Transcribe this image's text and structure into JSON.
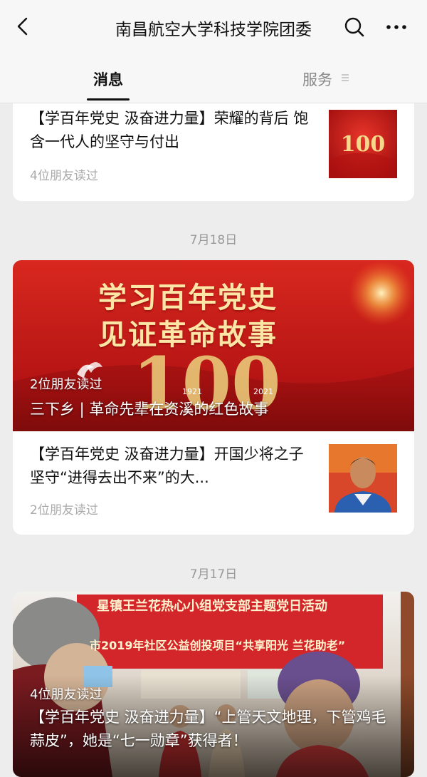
{
  "header": {
    "title": "南昌航空大学科技学院团委",
    "back_icon": "chevron-left-icon",
    "search_icon": "search-icon",
    "more_icon": "more-icon"
  },
  "tabs": {
    "messages": "消息",
    "services": "服务"
  },
  "feed": {
    "item1": {
      "title": "【学百年党史 汲奋进力量】荣耀的背后 饱含一代人的坚守与付出",
      "reads": "4位朋友读过",
      "thumb_text": "100"
    },
    "date1": "7月18日",
    "banner1": {
      "line1": "学习百年党史",
      "line2": "见证革命故事",
      "big_number": "100",
      "year_start": "1921",
      "year_end": "2021",
      "reads": "2位朋友读过",
      "title": "三下乡 | 革命先辈在资溪的红色故事"
    },
    "item2": {
      "title": "【学百年党史 汲奋进力量】开国少将之子坚守“进得去出不来”的大...",
      "reads": "2位朋友读过"
    },
    "date2": "7月17日",
    "banner2": {
      "banner_line1": "星镇王兰花热心小组党支部主题党日活动",
      "banner_line2": "市2019年社区公益创投项目“共享阳光 兰花助老”",
      "reads": "4位朋友读过",
      "title": "【学百年党史 汲奋进力量】“上管天文地理，下管鸡毛蒜皮”，她是“七一勋章”获得者！"
    }
  },
  "colors": {
    "header_bg": "#f7f7f7",
    "page_bg": "#ededed",
    "banner_red": "#c41a1a",
    "gold": "#f5d98a",
    "read_gray": "#aaaaaa"
  }
}
